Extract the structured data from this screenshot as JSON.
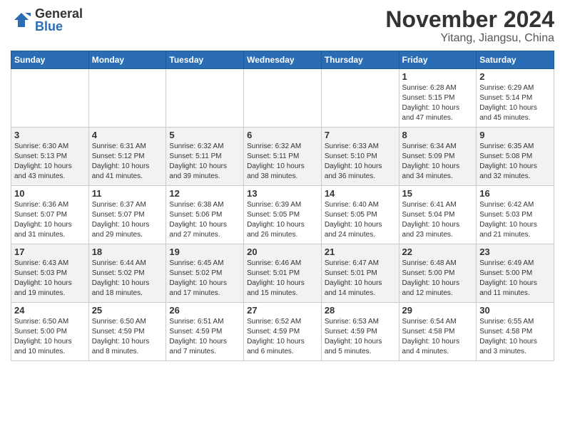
{
  "logo": {
    "general": "General",
    "blue": "Blue"
  },
  "title": "November 2024",
  "location": "Yitang, Jiangsu, China",
  "weekdays": [
    "Sunday",
    "Monday",
    "Tuesday",
    "Wednesday",
    "Thursday",
    "Friday",
    "Saturday"
  ],
  "weeks": [
    [
      {
        "day": "",
        "info": ""
      },
      {
        "day": "",
        "info": ""
      },
      {
        "day": "",
        "info": ""
      },
      {
        "day": "",
        "info": ""
      },
      {
        "day": "",
        "info": ""
      },
      {
        "day": "1",
        "info": "Sunrise: 6:28 AM\nSunset: 5:15 PM\nDaylight: 10 hours\nand 47 minutes."
      },
      {
        "day": "2",
        "info": "Sunrise: 6:29 AM\nSunset: 5:14 PM\nDaylight: 10 hours\nand 45 minutes."
      }
    ],
    [
      {
        "day": "3",
        "info": "Sunrise: 6:30 AM\nSunset: 5:13 PM\nDaylight: 10 hours\nand 43 minutes."
      },
      {
        "day": "4",
        "info": "Sunrise: 6:31 AM\nSunset: 5:12 PM\nDaylight: 10 hours\nand 41 minutes."
      },
      {
        "day": "5",
        "info": "Sunrise: 6:32 AM\nSunset: 5:11 PM\nDaylight: 10 hours\nand 39 minutes."
      },
      {
        "day": "6",
        "info": "Sunrise: 6:32 AM\nSunset: 5:11 PM\nDaylight: 10 hours\nand 38 minutes."
      },
      {
        "day": "7",
        "info": "Sunrise: 6:33 AM\nSunset: 5:10 PM\nDaylight: 10 hours\nand 36 minutes."
      },
      {
        "day": "8",
        "info": "Sunrise: 6:34 AM\nSunset: 5:09 PM\nDaylight: 10 hours\nand 34 minutes."
      },
      {
        "day": "9",
        "info": "Sunrise: 6:35 AM\nSunset: 5:08 PM\nDaylight: 10 hours\nand 32 minutes."
      }
    ],
    [
      {
        "day": "10",
        "info": "Sunrise: 6:36 AM\nSunset: 5:07 PM\nDaylight: 10 hours\nand 31 minutes."
      },
      {
        "day": "11",
        "info": "Sunrise: 6:37 AM\nSunset: 5:07 PM\nDaylight: 10 hours\nand 29 minutes."
      },
      {
        "day": "12",
        "info": "Sunrise: 6:38 AM\nSunset: 5:06 PM\nDaylight: 10 hours\nand 27 minutes."
      },
      {
        "day": "13",
        "info": "Sunrise: 6:39 AM\nSunset: 5:05 PM\nDaylight: 10 hours\nand 26 minutes."
      },
      {
        "day": "14",
        "info": "Sunrise: 6:40 AM\nSunset: 5:05 PM\nDaylight: 10 hours\nand 24 minutes."
      },
      {
        "day": "15",
        "info": "Sunrise: 6:41 AM\nSunset: 5:04 PM\nDaylight: 10 hours\nand 23 minutes."
      },
      {
        "day": "16",
        "info": "Sunrise: 6:42 AM\nSunset: 5:03 PM\nDaylight: 10 hours\nand 21 minutes."
      }
    ],
    [
      {
        "day": "17",
        "info": "Sunrise: 6:43 AM\nSunset: 5:03 PM\nDaylight: 10 hours\nand 19 minutes."
      },
      {
        "day": "18",
        "info": "Sunrise: 6:44 AM\nSunset: 5:02 PM\nDaylight: 10 hours\nand 18 minutes."
      },
      {
        "day": "19",
        "info": "Sunrise: 6:45 AM\nSunset: 5:02 PM\nDaylight: 10 hours\nand 17 minutes."
      },
      {
        "day": "20",
        "info": "Sunrise: 6:46 AM\nSunset: 5:01 PM\nDaylight: 10 hours\nand 15 minutes."
      },
      {
        "day": "21",
        "info": "Sunrise: 6:47 AM\nSunset: 5:01 PM\nDaylight: 10 hours\nand 14 minutes."
      },
      {
        "day": "22",
        "info": "Sunrise: 6:48 AM\nSunset: 5:00 PM\nDaylight: 10 hours\nand 12 minutes."
      },
      {
        "day": "23",
        "info": "Sunrise: 6:49 AM\nSunset: 5:00 PM\nDaylight: 10 hours\nand 11 minutes."
      }
    ],
    [
      {
        "day": "24",
        "info": "Sunrise: 6:50 AM\nSunset: 5:00 PM\nDaylight: 10 hours\nand 10 minutes."
      },
      {
        "day": "25",
        "info": "Sunrise: 6:50 AM\nSunset: 4:59 PM\nDaylight: 10 hours\nand 8 minutes."
      },
      {
        "day": "26",
        "info": "Sunrise: 6:51 AM\nSunset: 4:59 PM\nDaylight: 10 hours\nand 7 minutes."
      },
      {
        "day": "27",
        "info": "Sunrise: 6:52 AM\nSunset: 4:59 PM\nDaylight: 10 hours\nand 6 minutes."
      },
      {
        "day": "28",
        "info": "Sunrise: 6:53 AM\nSunset: 4:59 PM\nDaylight: 10 hours\nand 5 minutes."
      },
      {
        "day": "29",
        "info": "Sunrise: 6:54 AM\nSunset: 4:58 PM\nDaylight: 10 hours\nand 4 minutes."
      },
      {
        "day": "30",
        "info": "Sunrise: 6:55 AM\nSunset: 4:58 PM\nDaylight: 10 hours\nand 3 minutes."
      }
    ]
  ]
}
